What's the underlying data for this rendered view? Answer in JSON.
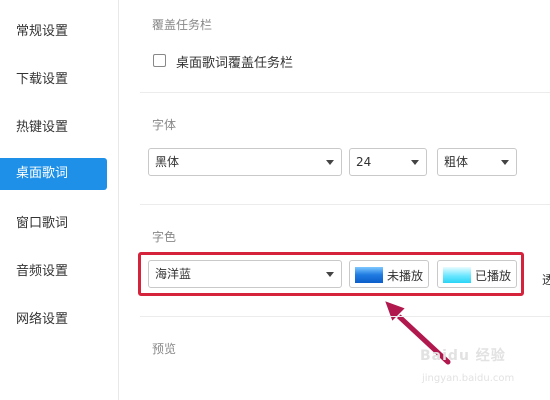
{
  "sidebar": {
    "items": [
      {
        "label": "常规设置"
      },
      {
        "label": "下载设置"
      },
      {
        "label": "热键设置"
      },
      {
        "label": "桌面歌词"
      },
      {
        "label": "窗口歌词"
      },
      {
        "label": "音频设置"
      },
      {
        "label": "网络设置"
      }
    ],
    "active_index": 3
  },
  "taskbar_section": {
    "title": "覆盖任务栏",
    "checkbox_label": "桌面歌词覆盖任务栏",
    "checked": false
  },
  "font_section": {
    "title": "字体",
    "family": "黑体",
    "size": "24",
    "weight": "粗体"
  },
  "color_section": {
    "title": "字色",
    "scheme": "海洋蓝",
    "unplayed_label": "未播放",
    "played_label": "已播放",
    "transparency_label": "透"
  },
  "preview_section": {
    "title": "预览"
  },
  "watermark": {
    "text": "Baidu 经验",
    "sub": "jingyan.baidu.com"
  },
  "colors": {
    "accent": "#1e90e8",
    "highlight_box": "#d6233c",
    "arrow": "#b0184e"
  }
}
